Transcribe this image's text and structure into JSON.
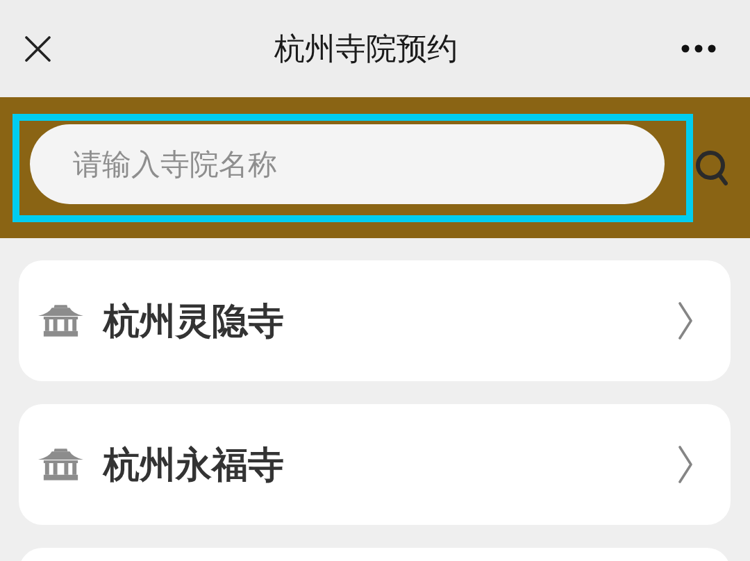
{
  "header": {
    "title": "杭州寺院预约"
  },
  "search": {
    "placeholder": "请输入寺院名称",
    "highlighted": true
  },
  "temples": [
    {
      "kind": "temple",
      "name": "杭州灵隐寺"
    },
    {
      "kind": "temple",
      "name": "杭州永福寺"
    },
    {
      "kind": "cut_off"
    }
  ]
}
